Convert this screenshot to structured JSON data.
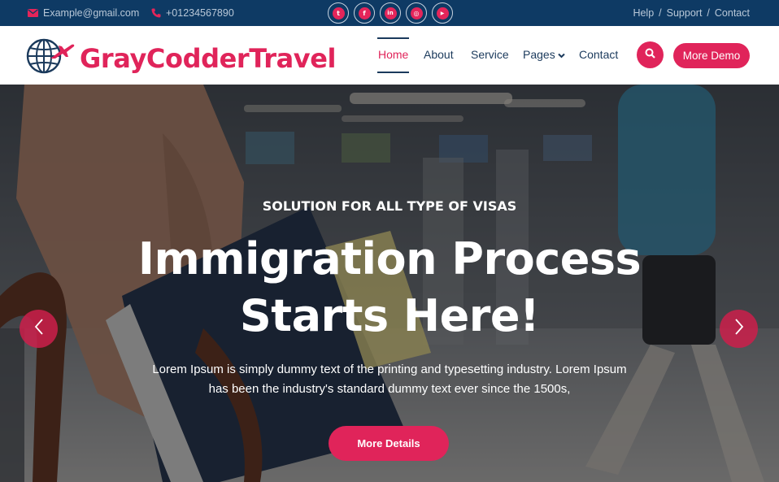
{
  "topbar": {
    "email": "Example@gmail.com",
    "phone": "+01234567890",
    "socials": [
      {
        "icon": "twitter-icon",
        "glyph": "t"
      },
      {
        "icon": "facebook-icon",
        "glyph": "f"
      },
      {
        "icon": "linkedin-icon",
        "glyph": "in"
      },
      {
        "icon": "instagram-icon",
        "glyph": "◎"
      },
      {
        "icon": "youtube-icon",
        "glyph": "▶"
      }
    ],
    "links": [
      "Help",
      "Support",
      "Contact"
    ],
    "separator": "/"
  },
  "header": {
    "logo_text": "GrayCodderTravel",
    "nav": {
      "home": "Home",
      "about": "About",
      "service": "Service",
      "pages": "Pages",
      "contact": "Contact"
    },
    "more_demo": "More Demo"
  },
  "hero": {
    "eyebrow": "SOLUTION FOR ALL TYPE OF VISAS",
    "headline_line1": "Immigration Process",
    "headline_line2": "Starts Here!",
    "description_line1": "Lorem Ipsum is simply dummy text of the printing and typesetting industry. Lorem Ipsum",
    "description_line2": "has been the industry's standard dummy text ever since the 1500s,",
    "cta": "More Details"
  },
  "colors": {
    "topbar_bg": "#0e3a64",
    "accent": "#e0245a",
    "nav_text": "#1b3a5c"
  }
}
